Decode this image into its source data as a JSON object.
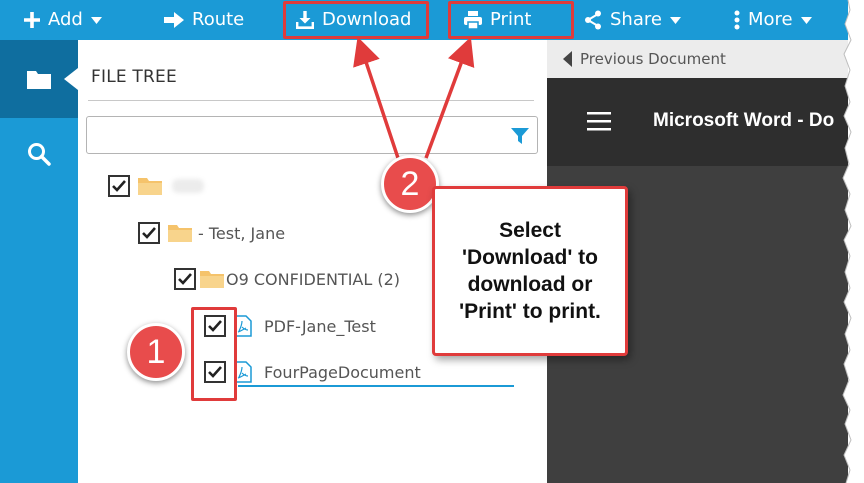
{
  "toolbar": {
    "add_label": "Add",
    "route_label": "Route",
    "download_label": "Download",
    "print_label": "Print",
    "share_label": "Share",
    "more_label": "More"
  },
  "rail": {
    "icons": [
      "folder-icon",
      "search-icon"
    ]
  },
  "file_tree": {
    "title": "FILE TREE",
    "search_value": "",
    "nodes": [
      {
        "label": "",
        "type": "folder",
        "checked": true,
        "level": 0
      },
      {
        "label": "- Test, Jane",
        "type": "folder",
        "checked": true,
        "level": 1
      },
      {
        "label": "O9 CONFIDENTIAL (2)",
        "type": "folder",
        "checked": true,
        "level": 2
      },
      {
        "label": "PDF-Jane_Test",
        "type": "pdf",
        "checked": true,
        "level": 3
      },
      {
        "label": "FourPageDocument",
        "type": "pdf",
        "checked": true,
        "level": 3
      }
    ]
  },
  "viewer": {
    "previous_document_label": "Previous Document",
    "title": "Microsoft Word - Do"
  },
  "annotations": {
    "step1": "1",
    "step2": "2",
    "callout_text": "Select\n'Download' to\ndownload or\n'Print' to print."
  },
  "colors": {
    "brand_blue": "#1b9ad6",
    "rail_active": "#0f6e9f",
    "annotation_red": "#e03b3b",
    "viewer_dark": "#2e2e2e"
  }
}
